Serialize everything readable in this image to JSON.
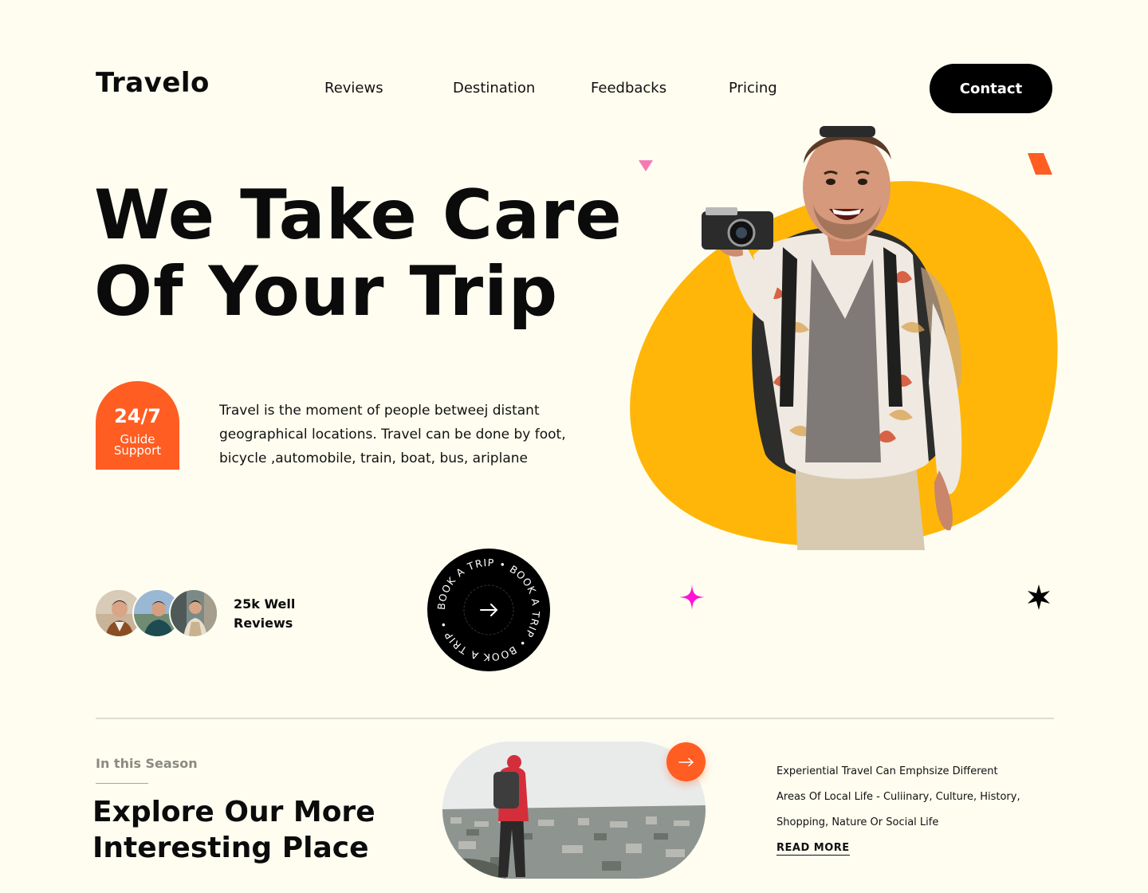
{
  "header": {
    "logo": "Travelo",
    "nav": [
      "Reviews",
      "Destination",
      "Feedbacks",
      "Pricing"
    ],
    "contact_label": "Contact"
  },
  "hero": {
    "title_line1": "We Take Care",
    "title_line2": "Of Your Trip",
    "badge_main": "24/7",
    "badge_sub_line1": "Guide",
    "badge_sub_line2": "Support",
    "description": "Travel is the moment of people betweej distant geographical locations. Travel can be done by foot, bicycle ,automobile, train, boat, bus, ariplane",
    "reviews_line1": "25k Well",
    "reviews_line2": "Reviews",
    "book_trip_text": "BOOK A TRIP • BOOK A TRIP • BOOK A TRIP •"
  },
  "season": {
    "eyebrow": "In this Season",
    "title_line1": "Explore Our More",
    "title_line2": "Interesting Place",
    "description_line1": "Experiential Travel Can Emphsize Different",
    "description_line2": "Areas Of Local Life - Culiinary, Culture, History,",
    "description_line3": "Shopping, Nature Or Social Life",
    "read_more": "READ MORE"
  },
  "colors": {
    "background": "#fefdf0",
    "accent_orange": "#ff5d22",
    "blob_yellow": "#ffb608",
    "sparkle_magenta": "#ff12d8",
    "triangle_pink": "#f779b4",
    "dark": "#000000"
  },
  "icons": {
    "book_trip_arrow": "arrow-right-icon",
    "place_arrow": "arrow-right-icon",
    "sparkle": "sparkle-icon",
    "star": "star-icon"
  }
}
